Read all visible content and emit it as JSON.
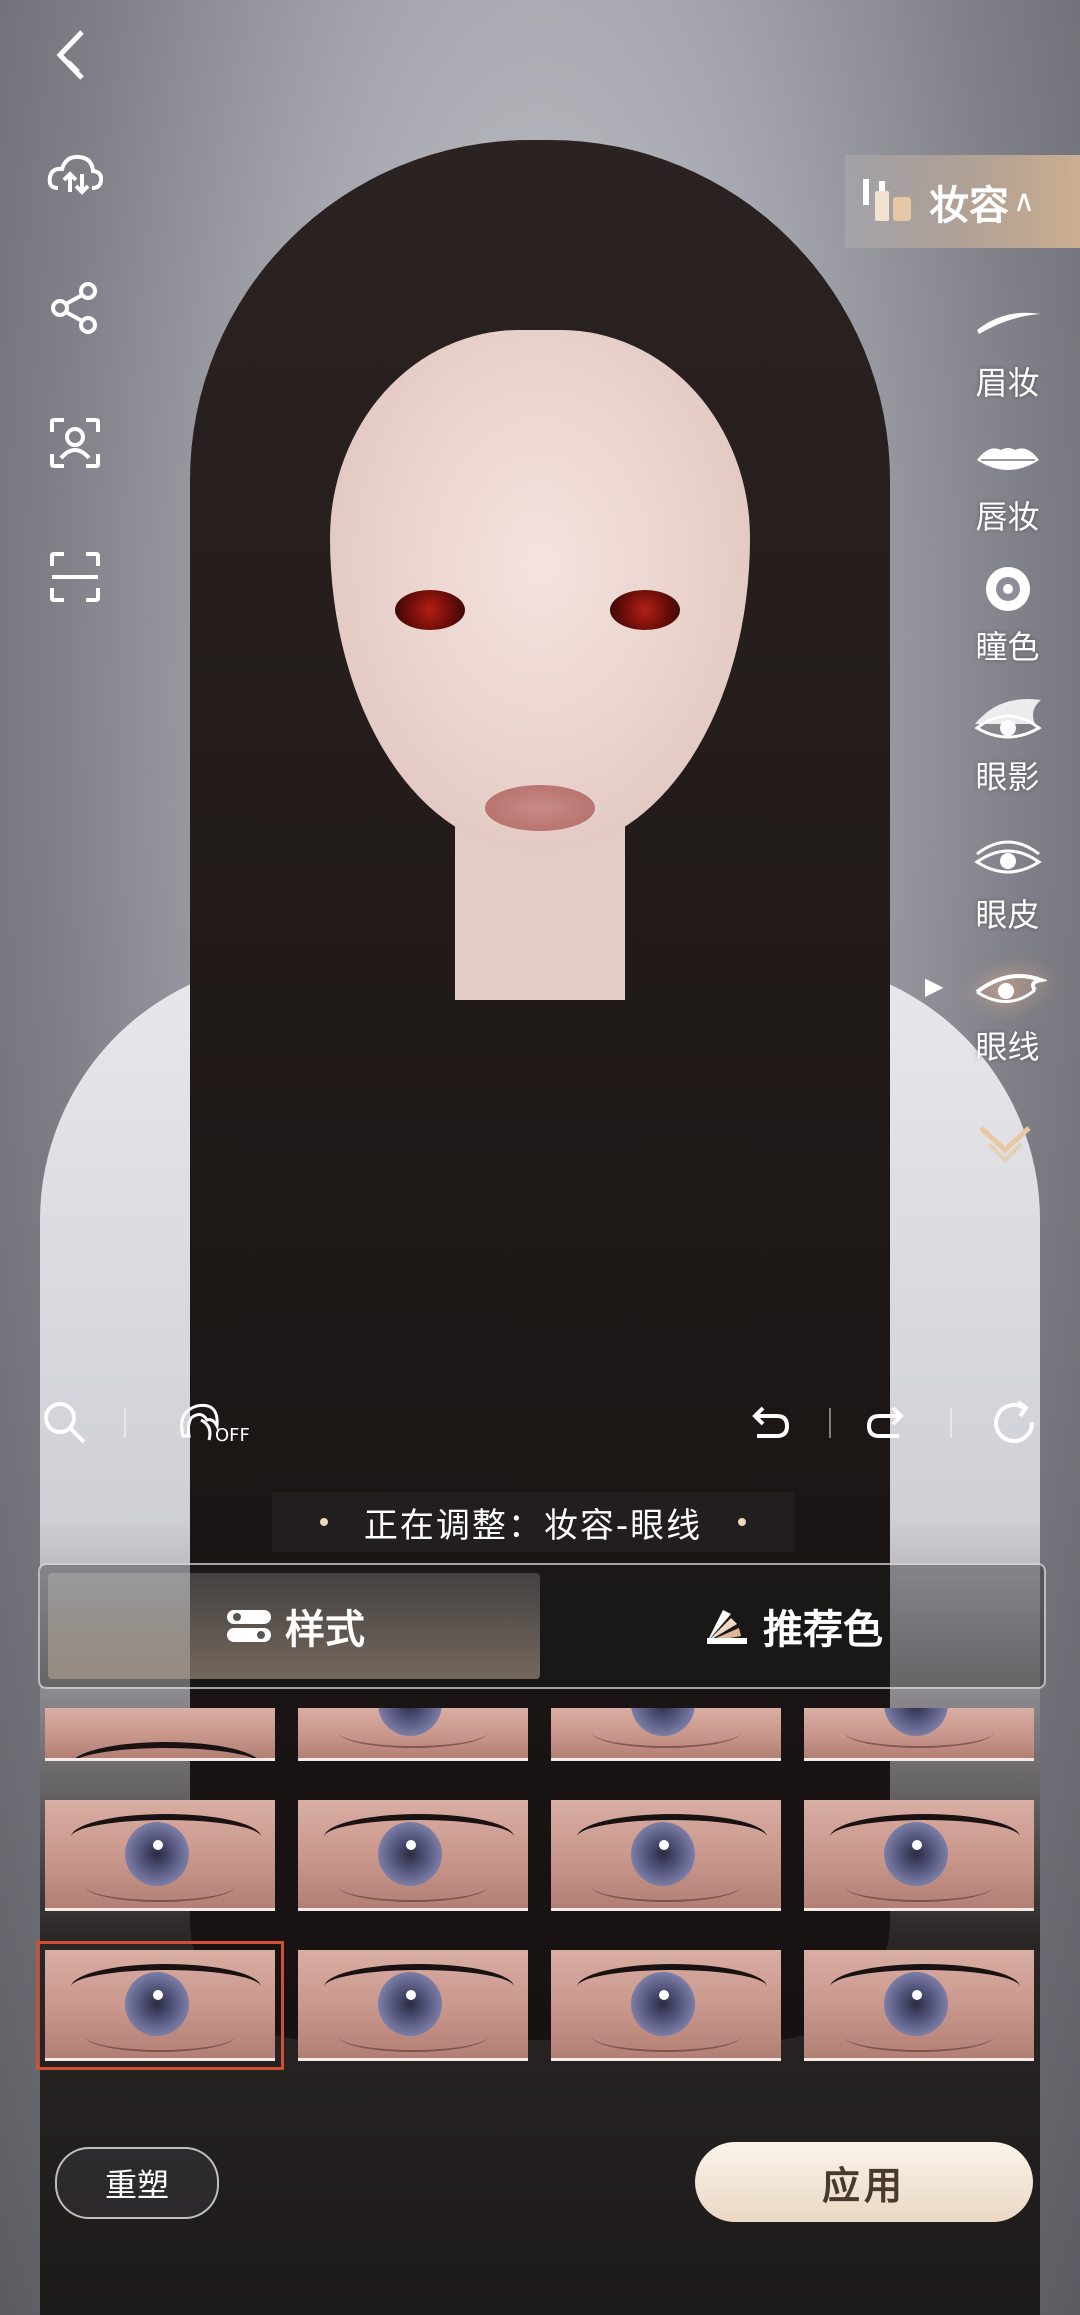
{
  "category": {
    "label": "妆容"
  },
  "categories": [
    {
      "label": "眉妆",
      "icon": "eyebrow-icon"
    },
    {
      "label": "唇妆",
      "icon": "lips-icon"
    },
    {
      "label": "瞳色",
      "icon": "pupil-icon"
    },
    {
      "label": "眼影",
      "icon": "eyeshadow-icon"
    },
    {
      "label": "眼皮",
      "icon": "eyelid-icon"
    },
    {
      "label": "眼线",
      "icon": "eyeliner-icon",
      "active": true
    }
  ],
  "toolbar": {
    "hair_toggle_state": "OFF"
  },
  "status": {
    "text": "正在调整：妆容-眼线"
  },
  "tabs": [
    {
      "label": "样式",
      "icon": "style-icon",
      "active": true
    },
    {
      "label": "推荐色",
      "icon": "palette-icon",
      "active": false
    }
  ],
  "eyeliner_grid": {
    "rows": 3,
    "columns": 4,
    "selected_row": 3,
    "selected_column": 1
  },
  "buttons": {
    "reshape": "重塑",
    "apply": "应用"
  },
  "colors": {
    "accent": "#d6b99a",
    "selection": "#d04e32",
    "apply_bg": "#f3e6d7"
  }
}
